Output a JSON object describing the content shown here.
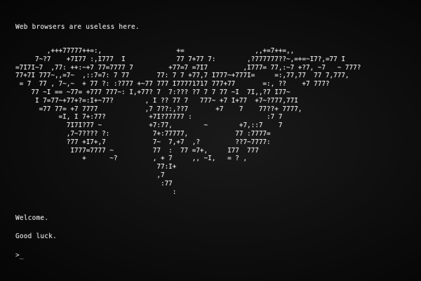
{
  "terminal": {
    "header_message": "Web browsers are useless here.",
    "ascii_art": "        ,+++77777++=:,                   +=                  ,,+=7++=,,\n     7~?7    +7I77 :,I777  I             77 7+77 7:        ,?777777??~,=+=~I7?,=77 I\n=7I7I~7  ,77: ++:~+7 77=7777 7         +77=7 =7I7         ,I777= 77,:~7 +?7, ~7   ~ 777?\n77+7I 777~,,=7~  ,::7=7: 7 77       77: 7 7 +77,7 I777~+777I=     =:,77,77  77 7,777,\n = 7  77 , 7~,~  + 77 ?: :?777 +~77 777 I77771717 777+77       =:, ??    +7 777?\n    77 ~I == ~77= +777 777~: I,+77? 7  7:??? ?7 7 7 77 ~I  7I,,?7 I77~\n     I 7=77~+77+?=:I+~77?        , I ?? 77 7   777~ +7 I+77  +7~?777,77I\n      =77 77= +7 7777            ,7 7??:,??7       +7    7    77??+ 7777,\n           =I, I 7+:77?           +7I?77777 :                   :7 7\n             7I7I?77 ~            +7:77,        ~        +7,::7    7\n             ,7~7???? ?:           7+:77777,            77 :7777=\n             ?77 +I7+,7            7~  7,+7  ,?         ??7~7777:\n              I777=7777 ~          77  :  77 =7+,     I77  777\n                 +      ~?         , + 7     ,, ~I,   = ? ,\n                                    77:I+\n                                    ,7\n                                     :77\n                                        :",
    "welcome_message": "Welcome.",
    "luck_message": "Good luck.",
    "prompt_symbol": ">",
    "cursor_symbol": "_"
  },
  "colors": {
    "background": "#0b0b0b",
    "text": "#e8e8e8"
  }
}
